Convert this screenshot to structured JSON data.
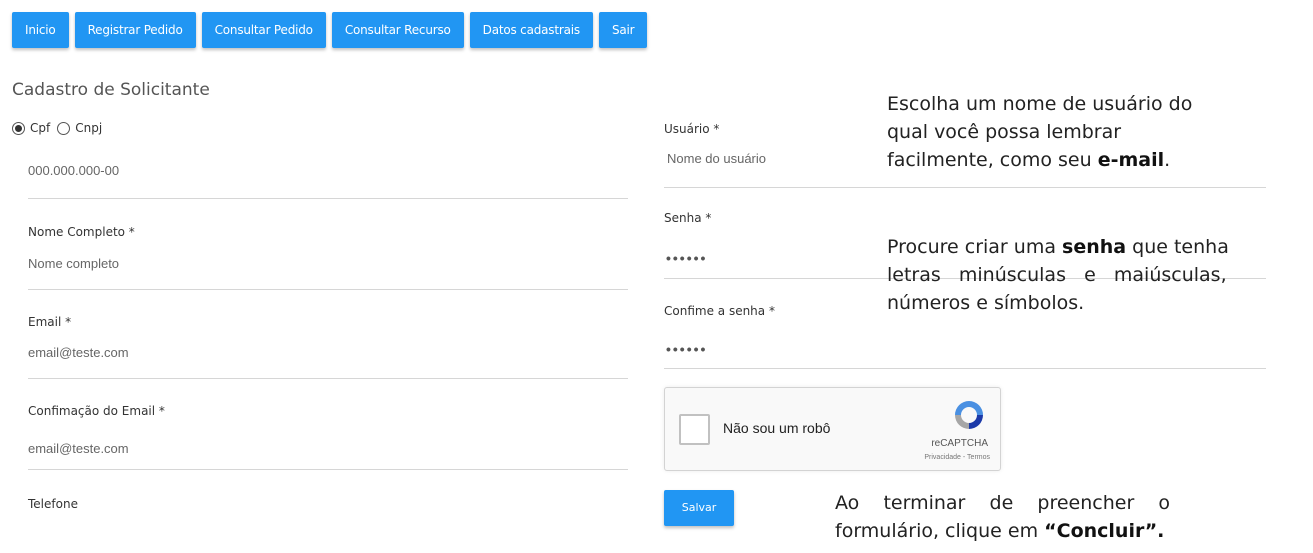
{
  "nav": {
    "items": [
      "Inicio",
      "Registrar Pedido",
      "Consultar Pedido",
      "Consultar Recurso",
      "Datos cadastrais",
      "Sair"
    ]
  },
  "form": {
    "title": "Cadastro de Solicitante",
    "doc_type": {
      "options": [
        "Cpf",
        "Cnpj"
      ],
      "selected": "Cpf"
    },
    "cpf_placeholder": "000.000.000-00",
    "nome_label": "Nome Completo *",
    "nome_placeholder": "Nome completo",
    "email_label": "Email *",
    "email_value": "email@teste.com",
    "email_confirm_label": "Confimação do Email *",
    "email_confirm_value": "email@teste.com",
    "telefone_label": "Telefone",
    "usuario_label": "Usuário *",
    "usuario_placeholder": "Nome do usuário",
    "senha_label": "Senha *",
    "senha_value": "••••••",
    "confirme_senha_label": "Confime a senha *",
    "confirme_senha_value": "••••••",
    "save_label": "Salvar"
  },
  "captcha": {
    "text": "Não sou um robô",
    "brand": "reCAPTCHA",
    "links": "Privacidade - Termos"
  },
  "notes": {
    "usuario": {
      "line1": "Escolha um nome de usuário do",
      "line2": "qual você possa lembrar",
      "line3_pre": "facilmente, como seu ",
      "line3_bold": "e-mail",
      "line3_post": "."
    },
    "senha": {
      "line1_pre": "Procure criar uma ",
      "line1_bold": "senha",
      "line1_post": " que tenha",
      "line2": "letras   minúsculas   e   maiúsculas,",
      "line3": "números e símbolos."
    },
    "concluir": {
      "line1": "Ao    terminar    de    preencher    o",
      "line2_pre": "formulário, clique em ",
      "line2_bold": "“Concluir”."
    }
  },
  "colors": {
    "primary": "#2196f3"
  }
}
